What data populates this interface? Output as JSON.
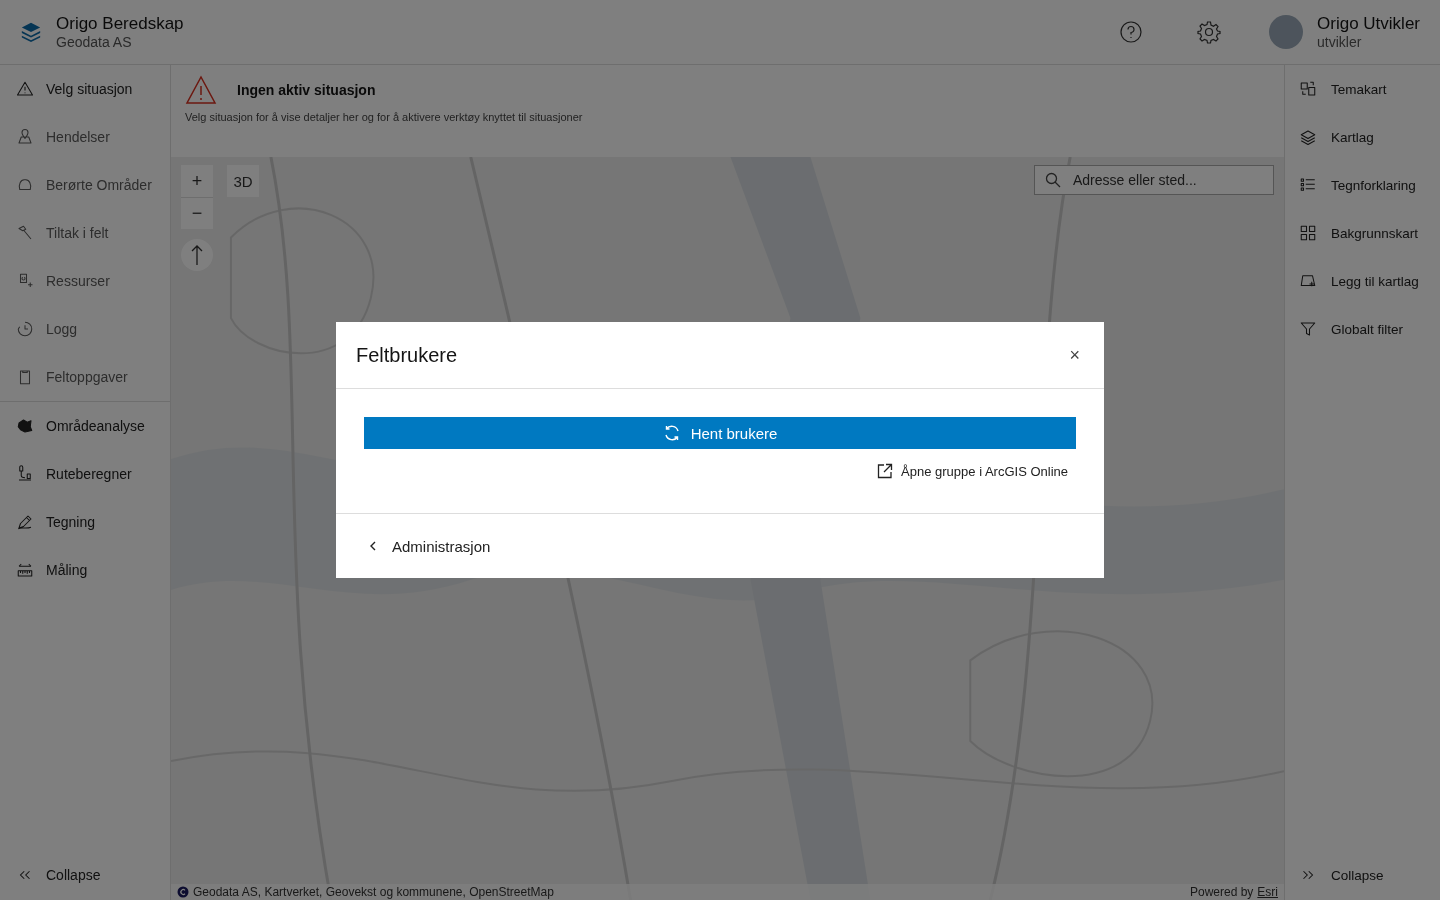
{
  "header": {
    "app_title": "Origo Beredskap",
    "organization": "Geodata AS",
    "user": {
      "name": "Origo Utvikler",
      "role": "utvikler"
    }
  },
  "sidebar": {
    "items": [
      {
        "label": "Velg situasjon",
        "kind": "warning",
        "disabled": false
      },
      {
        "label": "Hendelser",
        "kind": "pin",
        "disabled": true
      },
      {
        "label": "Berørte Områder",
        "kind": "area",
        "disabled": true
      },
      {
        "label": "Tiltak i felt",
        "kind": "hammer",
        "disabled": true
      },
      {
        "label": "Ressurser",
        "kind": "resource",
        "disabled": true
      },
      {
        "label": "Logg",
        "kind": "clock",
        "disabled": true
      },
      {
        "label": "Feltoppgaver",
        "kind": "clipboard",
        "disabled": true
      }
    ],
    "tools": [
      {
        "label": "Områdeanalyse",
        "kind": "blob",
        "disabled": false
      },
      {
        "label": "Ruteberegner",
        "kind": "route",
        "disabled": false
      },
      {
        "label": "Tegning",
        "kind": "pencil",
        "disabled": false
      },
      {
        "label": "Måling",
        "kind": "ruler",
        "disabled": false
      }
    ],
    "collapse": "Collapse"
  },
  "notice": {
    "title": "Ingen aktiv situasjon",
    "text": "Velg situasjon for å vise detaljer her og for å aktivere verktøy knyttet til situasjoner"
  },
  "map": {
    "zoom_in": "+",
    "zoom_out": "−",
    "view_3d": "3D",
    "search": {
      "placeholder": "Adresse eller sted..."
    },
    "attribution": "Geodata AS, Kartverket, Geovekst og kommunene, OpenStreetMap",
    "powered_by": "Powered by",
    "powered_link": "Esri"
  },
  "right_panel": {
    "items": [
      {
        "label": "Temakart",
        "kind": "theme"
      },
      {
        "label": "Kartlag",
        "kind": "layers"
      },
      {
        "label": "Tegnforklaring",
        "kind": "legend"
      },
      {
        "label": "Bakgrunnskart",
        "kind": "basemap"
      },
      {
        "label": "Legg til kartlag",
        "kind": "addlayer"
      },
      {
        "label": "Globalt filter",
        "kind": "filter"
      }
    ],
    "collapse": "Collapse"
  },
  "dialog": {
    "title": "Feltbrukere",
    "close": "×",
    "primary_button": "Hent brukere",
    "link": "Åpne gruppe i ArcGIS Online",
    "footer": "Administrasjon"
  }
}
